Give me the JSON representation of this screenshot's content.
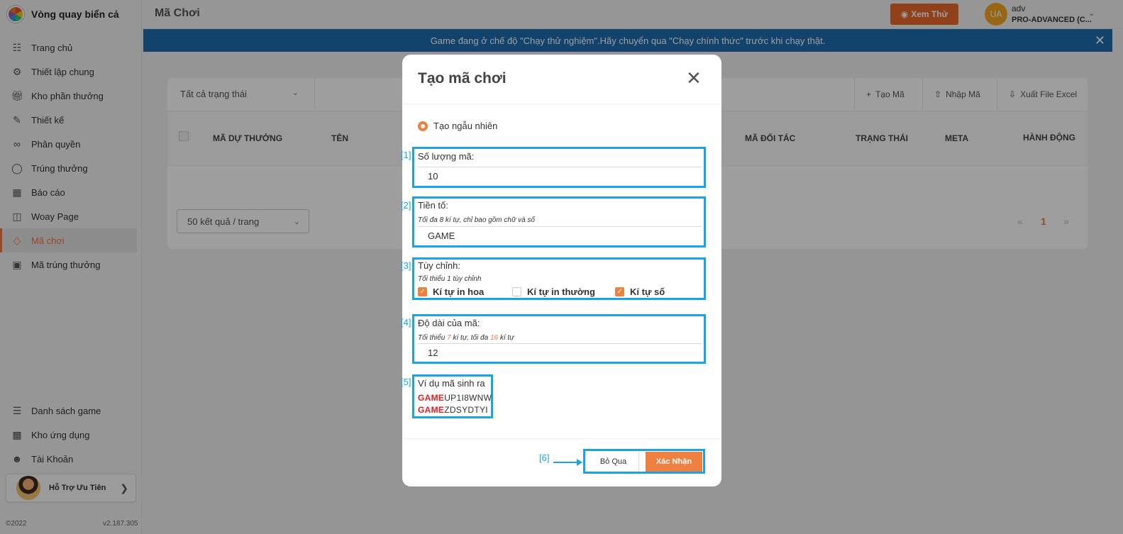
{
  "app": {
    "name": "Vòng quay biển cả"
  },
  "sidebar": {
    "items": [
      {
        "label": "Trang chủ",
        "icon": "book-icon"
      },
      {
        "label": "Thiết lập chung",
        "icon": "gear-icon"
      },
      {
        "label": "Kho phần thưởng",
        "icon": "gift-icon"
      },
      {
        "label": "Thiết kế",
        "icon": "edit-icon"
      },
      {
        "label": "Phân quyền",
        "icon": "link-icon"
      },
      {
        "label": "Trúng thưởng",
        "icon": "award-icon"
      },
      {
        "label": "Báo cáo",
        "icon": "grid-icon"
      },
      {
        "label": "Woay Page",
        "icon": "layout-icon"
      },
      {
        "label": "Mã chơi",
        "icon": "ticket-icon"
      },
      {
        "label": "Mã trúng thưởng",
        "icon": "gift-box-icon"
      }
    ],
    "active_index": 8,
    "bottom_items": [
      {
        "label": "Danh sách game",
        "icon": "menu-icon"
      },
      {
        "label": "Kho ứng dụng",
        "icon": "apps-icon"
      },
      {
        "label": "Tài Khoản",
        "icon": "user-icon"
      }
    ],
    "support_label": "Hỗ Trợ Ưu Tiên",
    "copyright": "©2022",
    "version": "v2.187.305"
  },
  "header": {
    "title": "Mã Chơi",
    "preview_label": "Xem Thử",
    "user_initials": "UA",
    "user_name": "adv",
    "user_plan": "PRO-ADVANCED (C..."
  },
  "banner": {
    "text": "Game đang ở chế độ \"Chạy thử nghiệm\".Hãy chuyển qua \"Chạy chính thức\" trước khi chạy thật."
  },
  "content": {
    "status_filter": "Tất cả trạng thái",
    "tools": {
      "create": "Tạo Mã",
      "import": "Nhập Mã",
      "export": "Xuất File Excel"
    },
    "columns": [
      "MÃ DỰ THƯỞNG",
      "TÊN",
      "MÃ ĐỐI TÁC",
      "TRẠNG THÁI",
      "META",
      "HÀNH ĐỘNG"
    ],
    "page_size": "50 kết quả / trang",
    "pager": {
      "prev": "«",
      "current": "1",
      "next": "»"
    }
  },
  "modal": {
    "title": "Tạo mã chơi",
    "mode_label": "Tạo ngẫu nhiên",
    "annotations": [
      "[1]",
      "[2]",
      "[3]",
      "[4]",
      "[5]",
      "[6]"
    ],
    "quantity": {
      "label": "Số lượng mã:",
      "value": "10"
    },
    "prefix": {
      "label": "Tiền tố:",
      "hint": "Tối đa 8 kí tự, chỉ bao gồm chữ và số",
      "value": "GAME"
    },
    "custom": {
      "label": "Tùy chỉnh:",
      "hint": "Tối thiểu 1 tùy chỉnh",
      "options": [
        {
          "label": "Kí tự in hoa",
          "checked": true
        },
        {
          "label": "Kí tự in thường",
          "checked": false
        },
        {
          "label": "Kí tự số",
          "checked": true
        }
      ]
    },
    "length": {
      "label": "Độ dài của mã:",
      "hint_pre": "Tối thiểu ",
      "hint_min": "7",
      "hint_mid": " kí tự, tối đa ",
      "hint_max": "16",
      "hint_post": " kí tự",
      "value": "12"
    },
    "example": {
      "label": "Ví dụ mã sinh ra",
      "codes": [
        {
          "prefix": "GAME",
          "suffix": "UP1I8WNW"
        },
        {
          "prefix": "GAME",
          "suffix": "ZDSYDTYI"
        }
      ]
    },
    "cancel_label": "Bỏ Qua",
    "confirm_label": "Xác Nhận"
  },
  "colors": {
    "accent": "#f08040",
    "banner": "#1c6cb0",
    "annotation": "#1aa3e8",
    "prefix_red": "#e02020"
  }
}
